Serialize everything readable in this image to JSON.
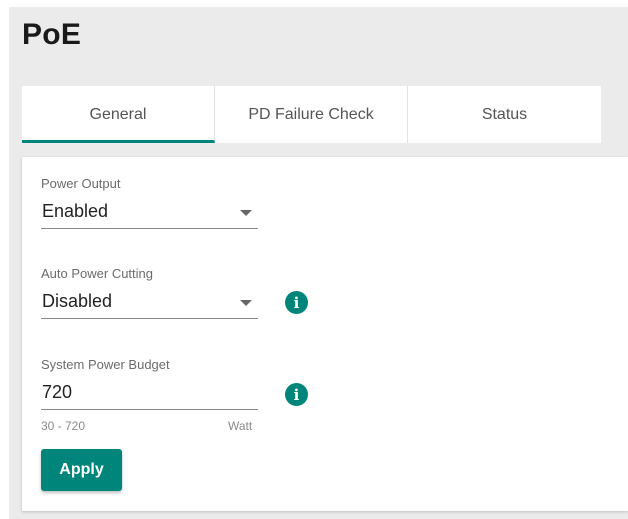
{
  "page": {
    "title": "PoE"
  },
  "tabs": [
    {
      "label": "General",
      "active": true
    },
    {
      "label": "PD Failure Check",
      "active": false
    },
    {
      "label": "Status",
      "active": false
    }
  ],
  "form": {
    "power_output": {
      "label": "Power Output",
      "value": "Enabled"
    },
    "auto_power_cutting": {
      "label": "Auto Power Cutting",
      "value": "Disabled",
      "icon": "info-icon"
    },
    "system_power_budget": {
      "label": "System Power Budget",
      "value": "720",
      "range_hint": "30 - 720",
      "unit": "Watt",
      "icon": "info-icon"
    },
    "apply_label": "Apply"
  },
  "colors": {
    "accent": "#00857b",
    "background": "#ebebeb",
    "card": "#ffffff"
  }
}
